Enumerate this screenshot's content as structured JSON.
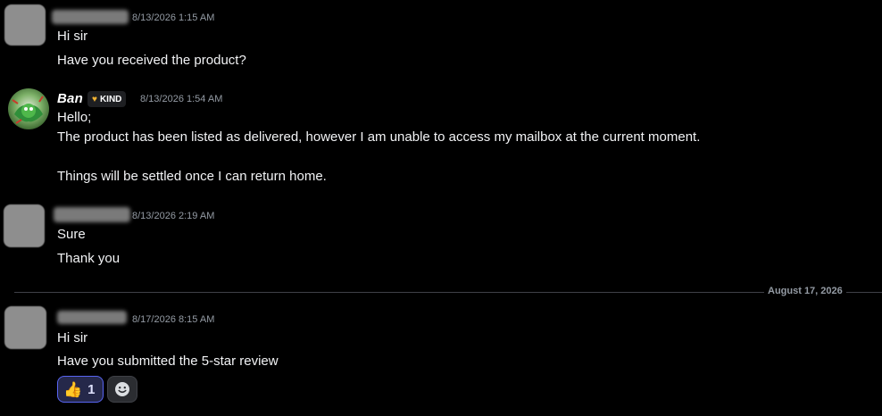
{
  "messages": [
    {
      "timestamp": "8/13/2026 1:15 AM",
      "lines": [
        "Hi sir",
        "Have you received the product?"
      ]
    },
    {
      "username": "Ban",
      "tag": "KIND",
      "timestamp": "8/13/2026 1:54 AM",
      "lines": [
        "Hello;",
        "The product has been listed as delivered, however I am unable to access my mailbox at the current moment.",
        "Things will be settled once I can return home."
      ]
    },
    {
      "timestamp": "8/13/2026 2:19 AM",
      "lines": [
        "Sure",
        "Thank you"
      ]
    },
    {
      "timestamp": "8/17/2026 8:15 AM",
      "lines": [
        "Hi sir",
        "Have you submitted the 5-star review"
      ]
    }
  ],
  "date_divider": "August 17, 2026",
  "reactions": [
    {
      "emoji": "👍",
      "count": "1",
      "icon": "thumbs-up-icon"
    },
    {
      "icon": "add-reaction-icon"
    }
  ],
  "colors": {
    "background": "#000000",
    "reaction_active_border": "#5865f2",
    "timestamp": "#949ba4"
  }
}
